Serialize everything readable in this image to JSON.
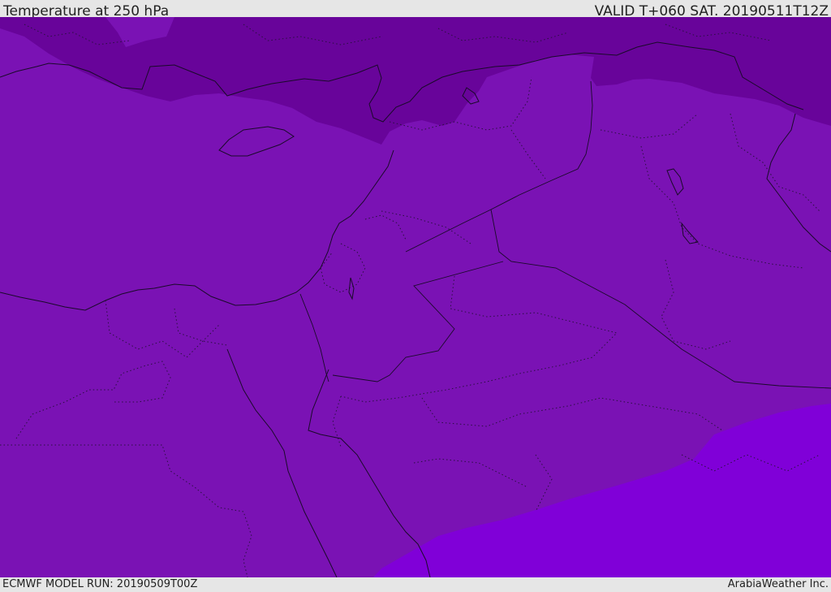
{
  "header": {
    "title": "Temperature at 250 hPa",
    "valid": "VALID T+060 SAT. 20190511T12Z"
  },
  "footer": {
    "model_run": "ECMWF MODEL RUN: 20190509T00Z",
    "credit": "ArabiaWeather Inc."
  },
  "colors": {
    "field_main": "#7a12b4",
    "field_cold": "#68049a",
    "field_warm": "#8000d8",
    "boundary": "#1a0a2a",
    "bar_background": "#e6e6e6"
  }
}
